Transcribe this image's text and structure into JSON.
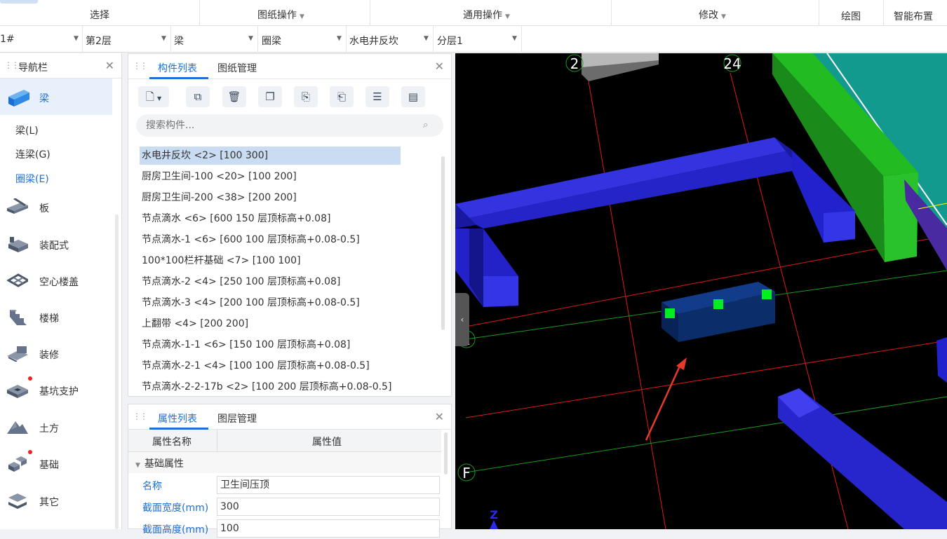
{
  "ribbon": {
    "select": "选择",
    "drawing_ops": "图纸操作",
    "general_ops": "通用操作",
    "modify": "修改",
    "draw": "绘图",
    "smart_layout": "智能布置"
  },
  "selectors": {
    "building": "1#",
    "floor": "第2层",
    "category": "梁",
    "type": "圈梁",
    "component": "水电井反坎",
    "layer": "分层1"
  },
  "nav": {
    "title": "导航栏",
    "selected_category": "梁",
    "sub_items": [
      "梁(L)",
      "连梁(G)",
      "圈梁(E)"
    ],
    "categories": [
      {
        "label": "板",
        "icon": "slab-icon"
      },
      {
        "label": "装配式",
        "icon": "prefab-icon"
      },
      {
        "label": "空心楼盖",
        "icon": "hollow-floor-icon"
      },
      {
        "label": "楼梯",
        "icon": "stair-icon"
      },
      {
        "label": "装修",
        "icon": "decoration-icon"
      },
      {
        "label": "基坑支护",
        "icon": "pit-support-icon"
      },
      {
        "label": "土方",
        "icon": "earthwork-icon"
      },
      {
        "label": "基础",
        "icon": "foundation-icon"
      },
      {
        "label": "其它",
        "icon": "other-icon"
      }
    ]
  },
  "component_panel": {
    "tab_list": "构件列表",
    "tab_drawing": "图纸管理",
    "search_placeholder": "搜索构件...",
    "items": [
      "水电井反坎 <2> [100 300]",
      "厨房卫生间-100 <20> [100 200]",
      "厨房卫生间-200 <38> [200 200]",
      "节点滴水 <6> [600 150 层顶标高+0.08]",
      "节点滴水-1 <6> [600 100 层顶标高+0.08-0.5]",
      "100*100栏杆基础 <7> [100 100]",
      "节点滴水-2 <4> [250 100 层顶标高+0.08]",
      "节点滴水-3 <4> [200 100 层顶标高+0.08-0.5]",
      "上翻带 <4> [200 200]",
      "节点滴水-1-1 <6> [150 100 层顶标高+0.08]",
      "节点滴水-2-1 <4> [100 100 层顶标高+0.08-0.5]",
      "节点滴水-2-2-17b <2> [100 200 层顶标高+0.08-0.5]"
    ]
  },
  "property_panel": {
    "tab_props": "属性列表",
    "tab_layers": "图层管理",
    "col_name": "属性名称",
    "col_value": "属性值",
    "group": "基础属性",
    "rows": [
      {
        "key": "名称",
        "value": "卫生间压顶"
      },
      {
        "key": "截面宽度(mm)",
        "value": "300"
      },
      {
        "key": "截面高度(mm)",
        "value": "100"
      }
    ]
  },
  "viewport": {
    "axis_24": "24",
    "axis_2": "2",
    "axis_F": "F",
    "axis_left": "1",
    "z_label": "Z"
  },
  "colors": {
    "accent": "#1f6fd6",
    "beam_blue": "#2222cc",
    "green_wall": "#22aa22",
    "teal_slab": "#139a8f",
    "selected_beam": "#0b2e6b",
    "grip_green": "#00ee22",
    "arrow_red": "#e8392b"
  }
}
